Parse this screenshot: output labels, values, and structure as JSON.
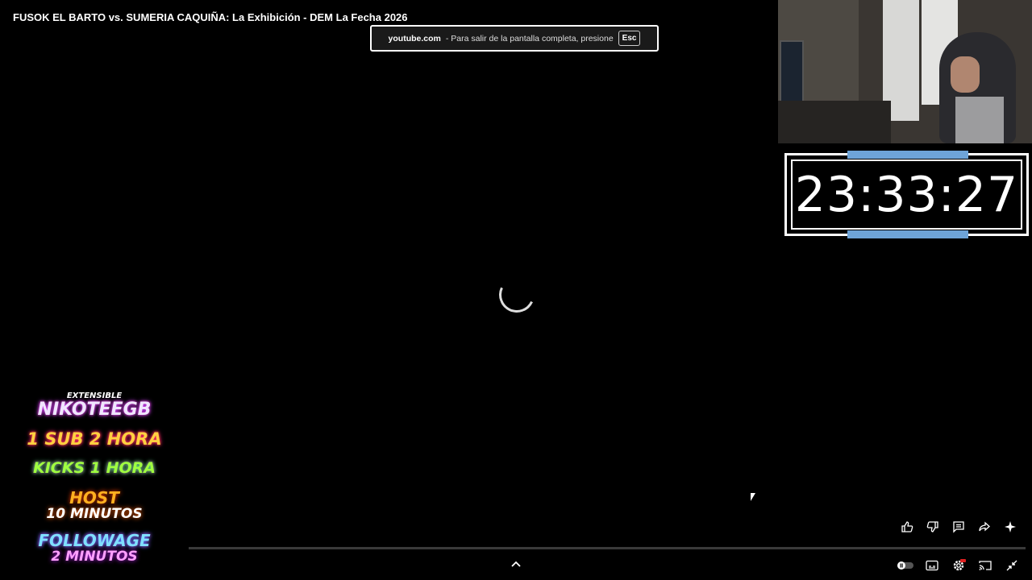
{
  "video": {
    "title": "FUSOK EL BARTO vs. SUMERIA CAQUIÑA: La Exhibición - DEM La Fecha 2026"
  },
  "fullscreen_notice": {
    "domain": "youtube.com",
    "message": "- Para salir de la pantalla completa, presione",
    "key": "Esc"
  },
  "overlay_clock": {
    "time": "23:33:27",
    "accent_color": "#6ea4d8"
  },
  "promo_overlay": {
    "lines": [
      "EXTENSIBLE",
      "NIKOTEEGB",
      "1 SUB 2 HORA",
      "KICKS 1 HORA",
      "HOST",
      "10 MINUTOS",
      "FOLLOWAGE",
      "2 MINUTOS"
    ]
  },
  "actions": [
    "like-icon",
    "dislike-icon",
    "comments-icon",
    "share-icon",
    "sparkle-icon"
  ],
  "controls": [
    "autoplay-toggle-icon",
    "subtitles-icon",
    "settings-icon",
    "cast-icon",
    "exit-fullscreen-icon"
  ]
}
